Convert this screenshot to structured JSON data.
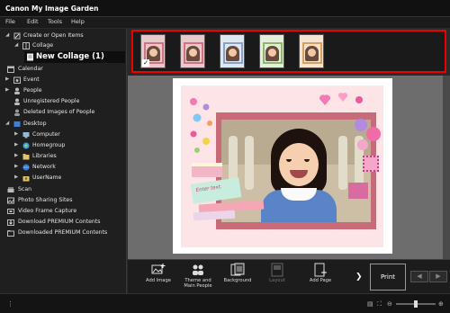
{
  "window": {
    "title": "Canon My Image Garden"
  },
  "menu": [
    "File",
    "Edit",
    "Tools",
    "Help"
  ],
  "sidebar": {
    "create_or_open": "Create or Open Items",
    "collage": "Collage",
    "new_collage": "New Collage (1)",
    "calendar": "Calendar",
    "event": "Event",
    "people": "People",
    "unregistered_people": "Unregistered People",
    "deleted_images": "Deleted Images of People",
    "desktop": "Desktop",
    "computer": "Computer",
    "homegroup": "Homegroup",
    "libraries": "Libraries",
    "network": "Network",
    "username": "UserName",
    "scan": "Scan",
    "photo_sharing": "Photo Sharing Sites",
    "video_frame": "Video Frame Capture",
    "download_premium": "Download PREMIUM Contents",
    "downloaded_premium": "Downloaded PREMIUM Contents"
  },
  "thumbnails": {
    "count": 5,
    "checked_index": 0
  },
  "canvas": {
    "note_text": "Enter text."
  },
  "toolbar": {
    "add_image": "Add Image",
    "theme_main_people": "Theme and\nMain People",
    "background": "Background",
    "layout": "Layout",
    "add_page": "Add Page",
    "print": "Print"
  },
  "colors": {
    "highlight_border": "#e00000",
    "card_bg": "#fde4e6",
    "frame": "#c86b78"
  }
}
